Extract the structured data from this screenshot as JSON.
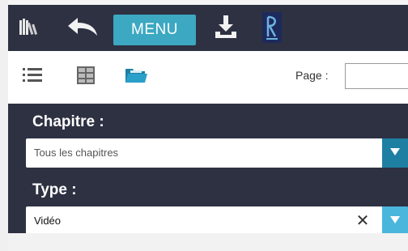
{
  "toolbar": {
    "menu_label": "MENU",
    "icons": [
      "library-icon",
      "back-arrow-icon",
      "download-icon",
      "brand-logo"
    ]
  },
  "subbar": {
    "icons": [
      "list-view-icon",
      "grid-view-icon",
      "folder-icon"
    ],
    "page_label": "Page :",
    "page_value": ""
  },
  "filters": {
    "chapitre_label": "Chapitre :",
    "chapitre_value": "Tous les chapitres",
    "type_label": "Type :",
    "type_value": "Vidéo",
    "clear_symbol": "✕",
    "arrow_symbol": "▼"
  },
  "colors": {
    "dark_bg": "#2d3142",
    "menu_button": "#3ca8c2",
    "arrow_dark": "#1f7fa3",
    "arrow_light": "#4bb6dc",
    "folder": "#2a9fc9"
  }
}
